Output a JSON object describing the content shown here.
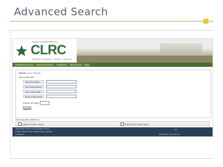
{
  "slide": {
    "title": "Advanced Search"
  },
  "colors": {
    "title_text": "#596472",
    "accent_gold": "#f0c820",
    "logo_green": "#2f6b3a",
    "nav_green": "#4a6e2c",
    "footer_navy": "#2b3f58"
  },
  "site": {
    "logo_top_text": "Northern Libraries With You",
    "logo_text": "CLRC",
    "logo_tagline": "Providing · Research · Creative · Solutions",
    "nav": [
      "Catalog & Services",
      "Advanced Search",
      "Collections",
      "My Account",
      "Help"
    ]
  },
  "search": {
    "heading": "Search",
    "heading_link": "Across all fields",
    "find_label": "Find results with:",
    "fields": [
      "All of the words",
      "The exact phrase",
      "Any of the words",
      "None of the words"
    ],
    "results_label": "Results per page",
    "button_label": "Search"
  },
  "collections": {
    "label": "Select specific collections:",
    "items": [
      "Lakeport Public Library",
      "Frankfort/Du Page Library"
    ]
  },
  "footer": {
    "left_lines": [
      "Adirondack & North Country Digital Library",
      "© 2007 Clinton Essex Franklin Library System",
      "Contact Us"
    ],
    "right_top": "Top",
    "right_bottom_prefix": "Powered by",
    "right_bottom_link": "CONTENTdm"
  }
}
